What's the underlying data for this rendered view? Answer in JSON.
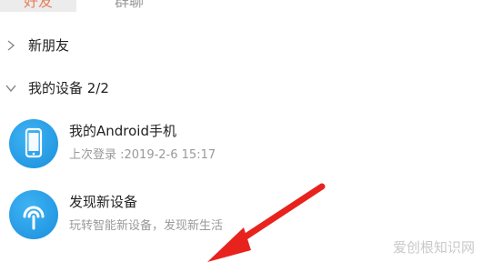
{
  "tabs": {
    "friends": "好友",
    "groups": "群聊"
  },
  "groups": {
    "new_friends": "新朋友",
    "my_devices": "我的设备 2/2"
  },
  "devices": [
    {
      "name": "我的Android手机",
      "sub": "上次登录 :2019-2-6 15:17",
      "icon": "phone-icon"
    },
    {
      "name": "发现新设备",
      "sub": "玩转智能新设备，发现新生活",
      "icon": "signal-icon"
    }
  ],
  "watermark": "爱创根知识网",
  "colors": {
    "accent": "#e5805c",
    "avatar_blue": "#1a8fdd",
    "arrow_red": "#e8231e"
  }
}
